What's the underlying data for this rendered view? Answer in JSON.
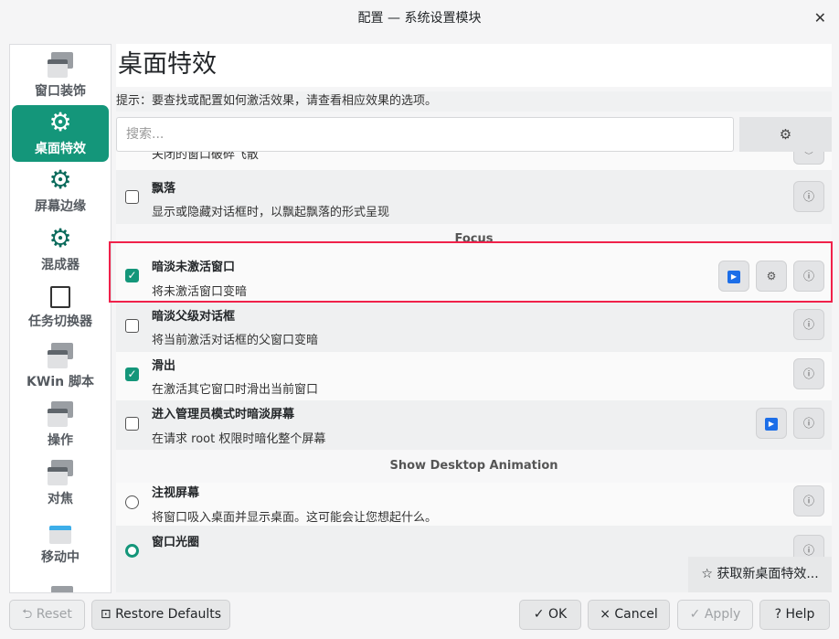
{
  "window": {
    "title": "配置 — 系统设置模块",
    "close_icon": "close-icon"
  },
  "sidebar": {
    "items": [
      {
        "label": "窗口装饰",
        "icon": "window-decoration-icon"
      },
      {
        "label": "桌面特效",
        "icon": "effects-gear-icon",
        "selected": true
      },
      {
        "label": "屏幕边缘",
        "icon": "gear-icon"
      },
      {
        "label": "混成器",
        "icon": "gear-icon"
      },
      {
        "label": "任务切换器",
        "icon": "task-switcher-icon"
      },
      {
        "label": "KWin 脚本",
        "icon": "window-icon"
      },
      {
        "label": "操作",
        "icon": "window-icon"
      },
      {
        "label": "对焦",
        "icon": "window-icon"
      },
      {
        "label": "移动中",
        "icon": "move-window-icon"
      }
    ]
  },
  "main": {
    "title": "桌面特效",
    "hint": "提示：要查找或配置如何激活效果，请查看相应效果的选项。",
    "search_placeholder": "搜索...",
    "partial_row_desc": "关闭的窗口破碎飞散",
    "effects": [
      {
        "name": "飘落",
        "desc": "显示或隐藏对话框时，以飘起飘落的形式呈现",
        "checked": false
      },
      {
        "section": "Focus"
      },
      {
        "name": "暗淡未激活窗口",
        "desc": "将未激活窗口变暗",
        "checked": true
      },
      {
        "name": "暗淡父级对话框",
        "desc": "将当前激活对话框的父窗口变暗",
        "checked": false
      },
      {
        "name": "滑出",
        "desc": "在激活其它窗口时滑出当前窗口",
        "checked": true
      },
      {
        "name": "进入管理员模式时暗淡屏幕",
        "desc": "在请求 root 权限时暗化整个屏幕",
        "checked": false
      },
      {
        "section": "Show Desktop Animation"
      },
      {
        "name": "注视屏幕",
        "desc": "将窗口吸入桌面并显示桌面。这可能会让您想起什么。",
        "checked": false
      },
      {
        "name": "窗口光圈",
        "checked": true
      }
    ],
    "get_new": "☆ 获取新桌面特效..."
  },
  "buttons": {
    "reset": "⮌ Reset",
    "restore": "⊡ Restore Defaults",
    "ok": "✓ OK",
    "cancel": "× Cancel",
    "apply": "✓ Apply",
    "help": "? Help"
  },
  "colors": {
    "accent": "#14967a",
    "highlight": "#f0214a",
    "video": "#1c6ee8"
  }
}
